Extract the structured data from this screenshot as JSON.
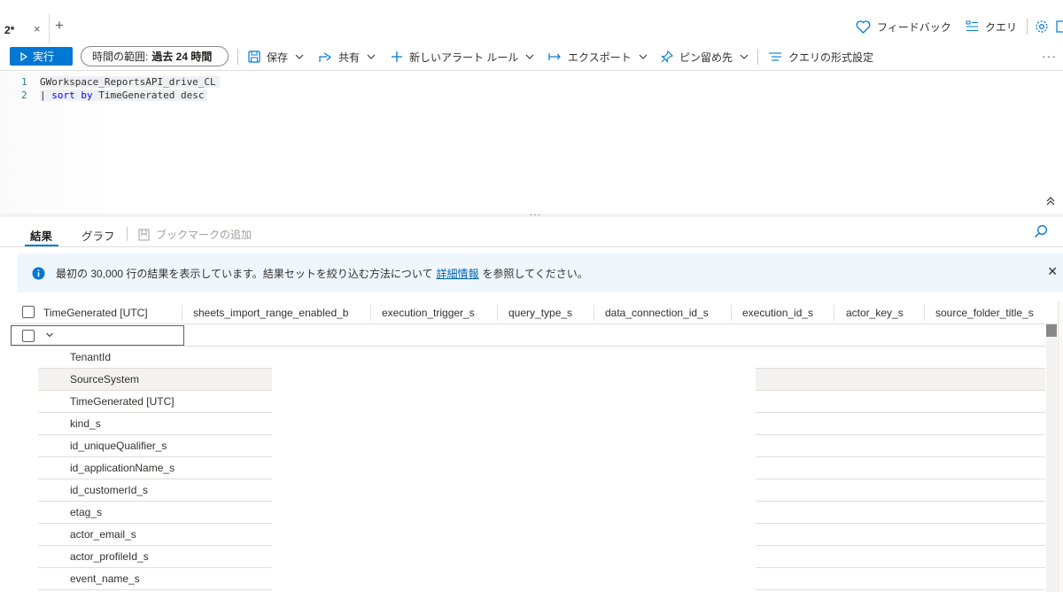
{
  "tab": {
    "title": "2*",
    "close_glyph": "×",
    "add_glyph": "+"
  },
  "top_actions": {
    "feedback": "フィードバック",
    "queries": "クエリ"
  },
  "toolbar": {
    "run": "実行",
    "time_range_label": "時間の範囲:",
    "time_range_value": "過去 24 時間",
    "save": "保存",
    "share": "共有",
    "new_alert": "新しいアラート ルール",
    "export": "エクスポート",
    "pin": "ピン留め先",
    "format": "クエリの形式設定",
    "more": "···"
  },
  "editor": {
    "line1_no": "1",
    "line1": "GWorkspace_ReportsAPI_drive_CL",
    "line2_no": "2",
    "line2_pipe": "| ",
    "line2_kw": "sort by",
    "line2_rest": " TimeGenerated desc"
  },
  "results": {
    "tab_results": "結果",
    "tab_chart": "グラフ",
    "add_bookmark": "ブックマークの追加"
  },
  "banner": {
    "text_before": "最初の 30,000 行の結果を表示しています。結果セットを絞り込む方法について",
    "link": "詳細情報",
    "text_after": "を参照してください。"
  },
  "columns": [
    "TimeGenerated [UTC]",
    "sheets_import_range_enabled_b",
    "execution_trigger_s",
    "query_type_s",
    "data_connection_id_s",
    "execution_id_s",
    "actor_key_s",
    "source_folder_title_s"
  ],
  "dropdown_items": [
    "TenantId",
    "SourceSystem",
    "TimeGenerated [UTC]",
    "kind_s",
    "id_uniqueQualifier_s",
    "id_applicationName_s",
    "id_customerId_s",
    "etag_s",
    "actor_email_s",
    "actor_profileId_s",
    "event_name_s"
  ],
  "colors": {
    "accent": "#0078d4",
    "banner_bg": "#eff6fc",
    "link": "#0063b1"
  }
}
